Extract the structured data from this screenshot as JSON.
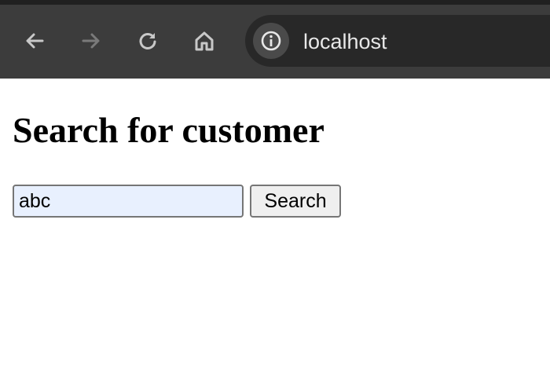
{
  "browser": {
    "url": "localhost",
    "icons": {
      "back": "arrow-left-icon",
      "forward": "arrow-right-icon",
      "reload": "reload-icon",
      "home": "home-icon",
      "site_info": "info-icon"
    },
    "colors": {
      "toolbar": "#3c3c3c",
      "omnibox": "#282828",
      "icon": "#c8c8c8",
      "icon_disabled": "#7a7a7a"
    }
  },
  "page": {
    "title": "Search for customer",
    "search": {
      "value": "abc",
      "button_label": "Search",
      "input_bg": "#e8f0fe"
    }
  }
}
